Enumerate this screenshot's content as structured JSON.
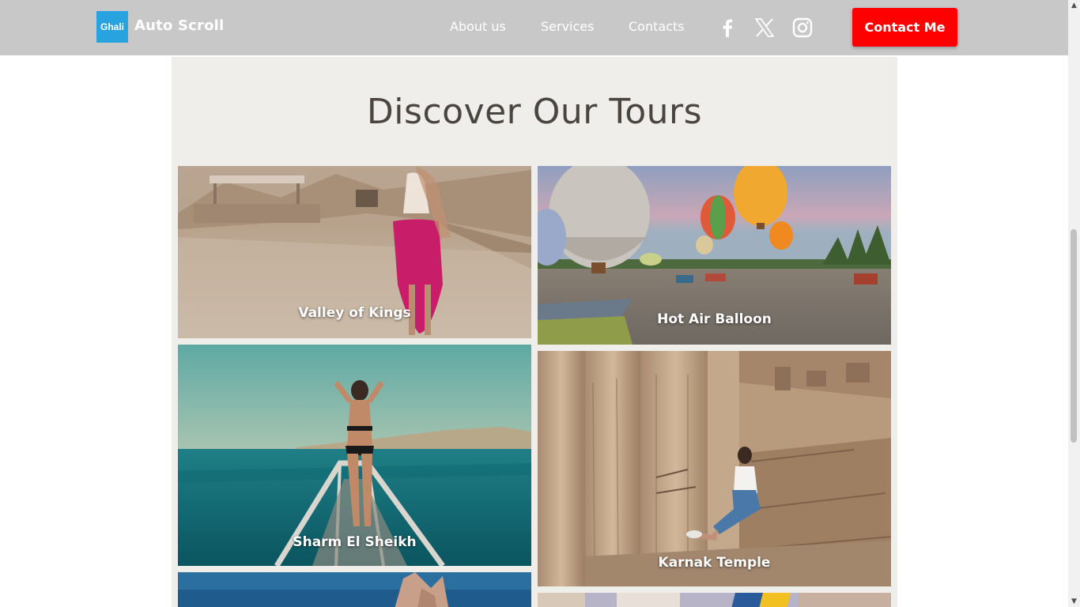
{
  "header": {
    "logo_text": "Ghali",
    "brand": "Auto Scroll",
    "nav": [
      "About us",
      "Services",
      "Contacts"
    ],
    "social_icons": [
      "facebook-icon",
      "x-icon",
      "instagram-icon"
    ],
    "cta_label": "Contact Me",
    "colors": {
      "navbar": "#c8c8c8",
      "logo": "#29a3e0",
      "cta": "#ff0000"
    }
  },
  "main": {
    "title": "Discover Our Tours",
    "tours": [
      {
        "label": "Valley of Kings"
      },
      {
        "label": "Hot Air Balloon"
      },
      {
        "label": "Sharm El Sheikh"
      },
      {
        "label": "Karnak Temple"
      }
    ]
  }
}
